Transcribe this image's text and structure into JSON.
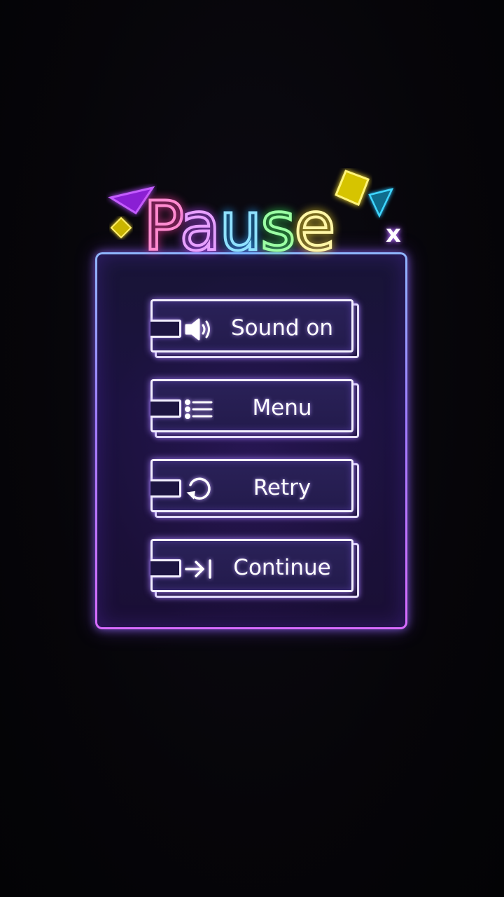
{
  "title": {
    "letters": [
      "P",
      "a",
      "u",
      "s",
      "e"
    ]
  },
  "close_label": "x",
  "buttons": [
    {
      "label": "Sound on",
      "icon": "speaker-icon"
    },
    {
      "label": "Menu",
      "icon": "list-icon"
    },
    {
      "label": "Retry",
      "icon": "retry-icon"
    },
    {
      "label": "Continue",
      "icon": "skip-to-end-icon"
    }
  ],
  "colors": {
    "pink": "#ff77c4",
    "purple": "#e08cff",
    "cyan": "#7fd8ff",
    "green": "#8fff9b",
    "yellow": "#fff49a",
    "panel_border": "#a07cff",
    "button_stroke": "#f3f0ff"
  }
}
